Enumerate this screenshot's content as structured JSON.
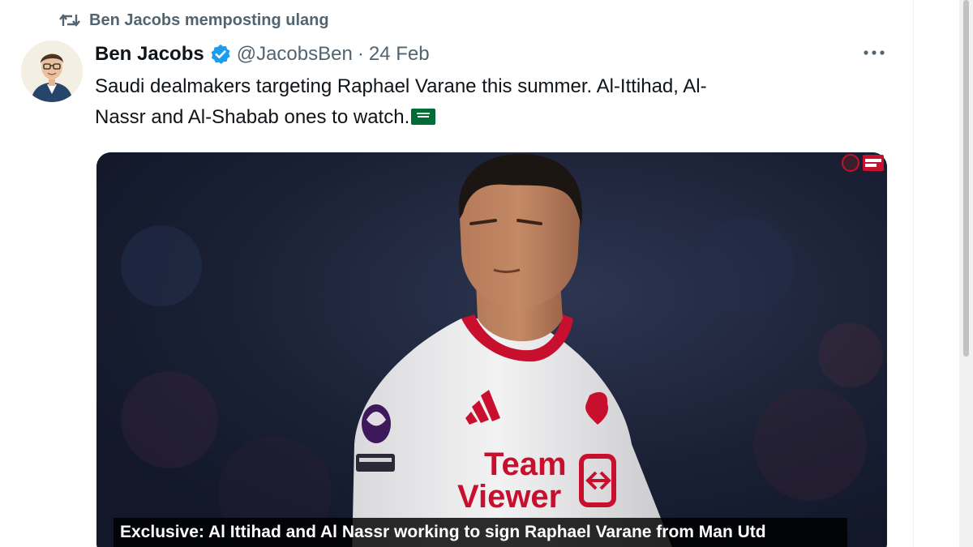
{
  "repost": {
    "label": "Ben Jacobs memposting ulang",
    "icon": "repost-icon"
  },
  "tweet": {
    "display_name": "Ben Jacobs",
    "verified_icon": "verified-badge-icon",
    "handle": "@JacobsBen",
    "separator": "·",
    "date": "24 Feb",
    "text_line1": "Saudi dealmakers targeting Raphael Varane this summer. Al-Ittihad, Al-",
    "text_line2": "Nassr and Al-Shabab ones to watch.",
    "flag_icon": "saudi-flag-emoji",
    "more_icon": "more-options-icon"
  },
  "media": {
    "sponsor_line1": "Team",
    "sponsor_line2": "Viewer",
    "caption": "Exclusive: Al Ittihad and Al Nassr working to sign Raphael Varane from Man Utd"
  },
  "colors": {
    "text_primary": "#0f1419",
    "text_secondary": "#536471",
    "verified_blue": "#1d9bf0",
    "shirt_trim": "#c8102e"
  }
}
